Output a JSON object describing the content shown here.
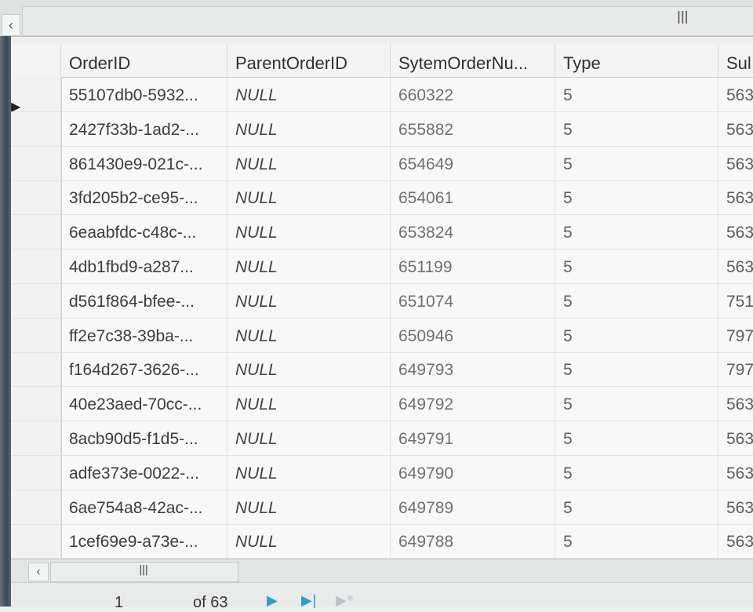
{
  "grid": {
    "columns": [
      "OrderID",
      "ParentOrderID",
      "SytemOrderNu...",
      "Type",
      "Sul"
    ],
    "rows": [
      {
        "order_id": "55107db0-5932...",
        "parent": "NULL",
        "sys": "660322",
        "type": "5",
        "sub": "563"
      },
      {
        "order_id": "2427f33b-1ad2-...",
        "parent": "NULL",
        "sys": "655882",
        "type": "5",
        "sub": "563"
      },
      {
        "order_id": "861430e9-021c-...",
        "parent": "NULL",
        "sys": "654649",
        "type": "5",
        "sub": "563"
      },
      {
        "order_id": "3fd205b2-ce95-...",
        "parent": "NULL",
        "sys": "654061",
        "type": "5",
        "sub": "563"
      },
      {
        "order_id": "6eaabfdc-c48c-...",
        "parent": "NULL",
        "sys": "653824",
        "type": "5",
        "sub": "563"
      },
      {
        "order_id": "4db1fbd9-a287...",
        "parent": "NULL",
        "sys": "651199",
        "type": "5",
        "sub": "563"
      },
      {
        "order_id": "d561f864-bfee-...",
        "parent": "NULL",
        "sys": "651074",
        "type": "5",
        "sub": "751"
      },
      {
        "order_id": "ff2e7c38-39ba-...",
        "parent": "NULL",
        "sys": "650946",
        "type": "5",
        "sub": "797"
      },
      {
        "order_id": "f164d267-3626-...",
        "parent": "NULL",
        "sys": "649793",
        "type": "5",
        "sub": "797"
      },
      {
        "order_id": "40e23aed-70cc-...",
        "parent": "NULL",
        "sys": "649792",
        "type": "5",
        "sub": "563"
      },
      {
        "order_id": "8acb90d5-f1d5-...",
        "parent": "NULL",
        "sys": "649791",
        "type": "5",
        "sub": "563"
      },
      {
        "order_id": "adfe373e-0022-...",
        "parent": "NULL",
        "sys": "649790",
        "type": "5",
        "sub": "563"
      },
      {
        "order_id": "6ae754a8-42ac-...",
        "parent": "NULL",
        "sys": "649789",
        "type": "5",
        "sub": "563"
      },
      {
        "order_id": "1cef69e9-a73e-...",
        "parent": "NULL",
        "sys": "649788",
        "type": "5",
        "sub": "563"
      }
    ]
  },
  "pager": {
    "page": "1",
    "of_label": "of 63"
  },
  "icons": {
    "scroll_left": "chevron-left-icon",
    "scroll_grip": "grip-icon",
    "row_indicator": "current-row-arrow-icon",
    "next_page": "play-icon",
    "last_page": "skip-end-icon"
  }
}
